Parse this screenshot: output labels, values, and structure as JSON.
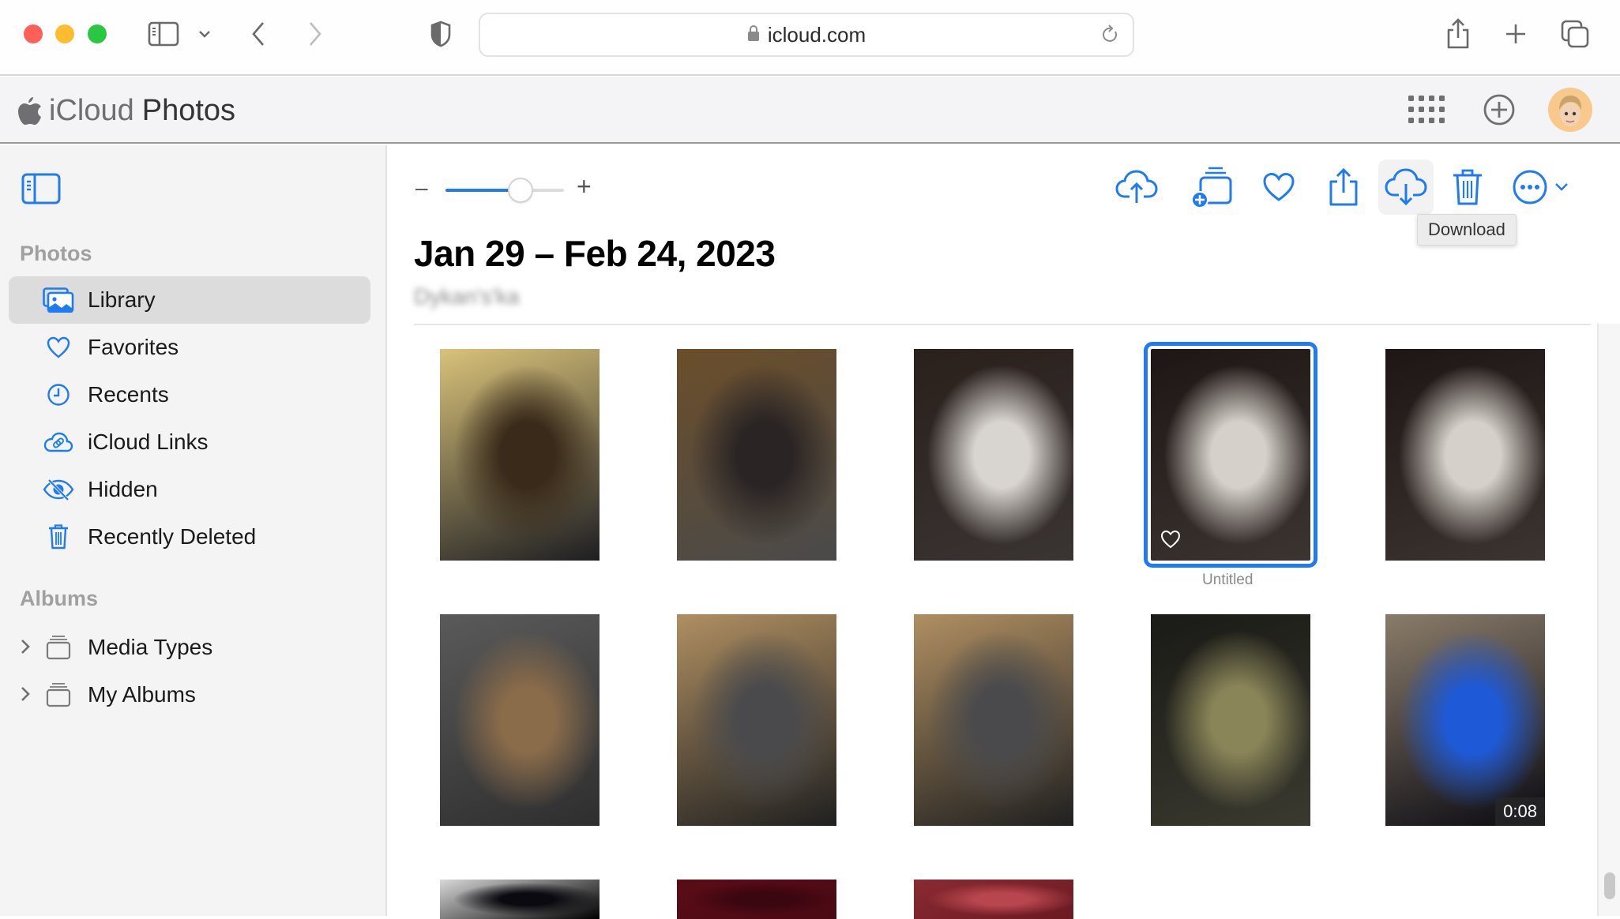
{
  "browser": {
    "url": "icloud.com",
    "traffic_colors": {
      "close": "#fe5f57",
      "minimize": "#febc2e",
      "zoom": "#28c840"
    }
  },
  "app": {
    "title_brand": "iCloud",
    "title_product": "Photos"
  },
  "sidebar": {
    "sections": [
      {
        "label": "Photos"
      },
      {
        "label": "Albums"
      }
    ],
    "items": [
      {
        "label": "Library",
        "icon": "library-icon",
        "active": true
      },
      {
        "label": "Favorites",
        "icon": "heart-icon"
      },
      {
        "label": "Recents",
        "icon": "clock-icon"
      },
      {
        "label": "iCloud Links",
        "icon": "cloud-link-icon"
      },
      {
        "label": "Hidden",
        "icon": "eye-slash-icon"
      },
      {
        "label": "Recently Deleted",
        "icon": "trash-icon"
      }
    ],
    "albums": [
      {
        "label": "Media Types",
        "icon": "album-stack-icon"
      },
      {
        "label": "My Albums",
        "icon": "album-stack-icon"
      }
    ]
  },
  "toolbar": {
    "zoom_minus": "–",
    "zoom_plus": "+",
    "zoom_level_fraction": 0.63,
    "actions": [
      {
        "name": "upload",
        "icon": "cloud-upload-icon"
      },
      {
        "name": "add-to-album",
        "icon": "add-to-album-icon"
      },
      {
        "name": "favorite",
        "icon": "heart-icon"
      },
      {
        "name": "share",
        "icon": "share-icon"
      },
      {
        "name": "download",
        "icon": "cloud-download-icon",
        "hovered": true
      },
      {
        "name": "delete",
        "icon": "trash-icon"
      },
      {
        "name": "more",
        "icon": "ellipsis-circle-icon"
      }
    ],
    "tooltip": "Download"
  },
  "content": {
    "title": "Jan 29 – Feb 24, 2023",
    "subtitle": "Dykan's'ka",
    "photos": [
      {
        "caption": "",
        "selected": false,
        "colors": [
          "#d9c27a",
          "#3a2a1a",
          "#1e1e22"
        ]
      },
      {
        "caption": "",
        "selected": false,
        "colors": [
          "#6b4e2a",
          "#2a2424",
          "#4a4a4a"
        ]
      },
      {
        "caption": "",
        "selected": false,
        "colors": [
          "#2a201c",
          "#d8d4cf",
          "#3a3432"
        ]
      },
      {
        "caption": "Untitled",
        "selected": true,
        "favorite": true,
        "colors": [
          "#1e1614",
          "#d5d0ca",
          "#3c3430"
        ]
      },
      {
        "caption": "",
        "selected": false,
        "colors": [
          "#1e1614",
          "#d5d0ca",
          "#3c3430"
        ]
      },
      {
        "caption": "",
        "selected": false,
        "colors": [
          "#5a5a5a",
          "#8a6b4a",
          "#2e2e2e"
        ]
      },
      {
        "caption": "",
        "selected": false,
        "colors": [
          "#b08f62",
          "#4a4a4c",
          "#202020"
        ]
      },
      {
        "caption": "",
        "selected": false,
        "colors": [
          "#b08f62",
          "#4a4a4c",
          "#202020"
        ]
      },
      {
        "caption": "",
        "selected": false,
        "colors": [
          "#1a1a16",
          "#8a8558",
          "#3a3a30"
        ]
      },
      {
        "caption": "",
        "selected": false,
        "duration": "0:08",
        "colors": [
          "#8a7c6a",
          "#1e5ad8",
          "#0a0a12"
        ]
      },
      {
        "caption": "",
        "selected": false,
        "colors": [
          "#d8d8d8",
          "#0a0a10",
          "#000000"
        ]
      },
      {
        "caption": "",
        "selected": false,
        "colors": [
          "#5a0c16",
          "#3a0610",
          "#4a0a14"
        ]
      },
      {
        "caption": "",
        "selected": false,
        "colors": [
          "#8a2a32",
          "#b8464e",
          "#6a1a22"
        ]
      }
    ]
  },
  "colors": {
    "accent": "#1f7bf2",
    "sidebar_bg": "#f4f4f4",
    "active_item_bg": "#dcdcdc"
  }
}
